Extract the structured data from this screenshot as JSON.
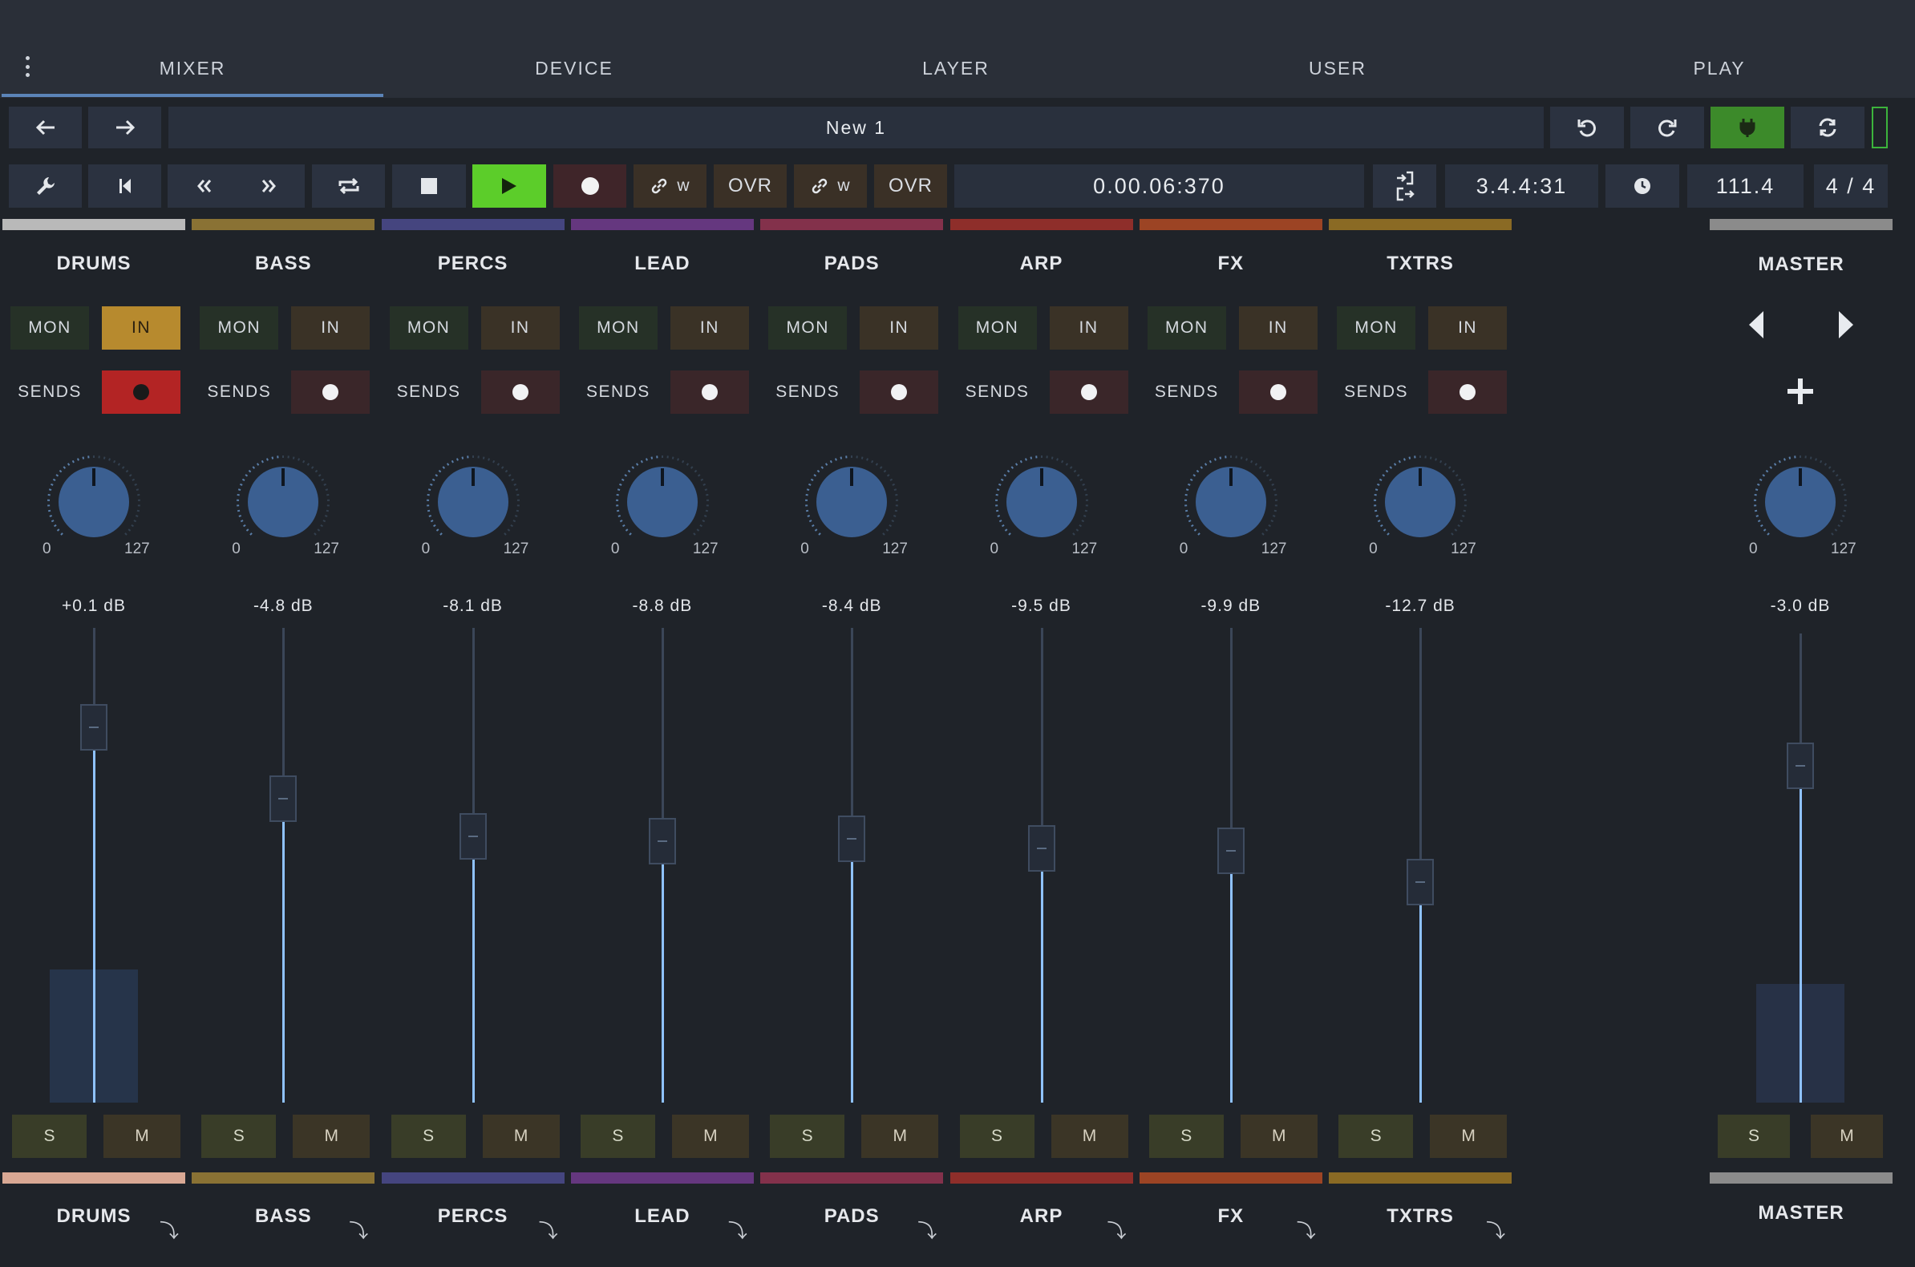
{
  "tabs": [
    {
      "label": "MIXER",
      "active": true
    },
    {
      "label": "DEVICE",
      "active": false
    },
    {
      "label": "LAYER",
      "active": false
    },
    {
      "label": "USER",
      "active": false
    },
    {
      "label": "PLAY",
      "active": false
    }
  ],
  "toolbar": {
    "project_name": "New 1",
    "time": "0.00.06:370",
    "position": "3.4.4:31",
    "tempo": "111.4",
    "time_signature": "4 / 4",
    "link1_label": "w",
    "overdub1_label": "OVR",
    "link2_label": "w",
    "overdub2_label": "OVR"
  },
  "tracks": [
    {
      "name": "DRUMS",
      "color": "#b9b9b9",
      "bottom_color": "#d9a894",
      "mon": "MON",
      "in": "IN",
      "in_active": true,
      "sends": "SENDS",
      "rec_active": true,
      "knob_min": "0",
      "knob_max": "127",
      "volume": "+0.1 dB",
      "fader_level": 0.79,
      "meter_level": 0.28,
      "solo": "S",
      "mute": "M",
      "routing": "⤵"
    },
    {
      "name": "BASS",
      "color": "#8a7234",
      "bottom_color": "#8a7234",
      "mon": "MON",
      "in": "IN",
      "in_active": false,
      "sends": "SENDS",
      "rec_active": false,
      "knob_min": "0",
      "knob_max": "127",
      "volume": "-4.8 dB",
      "fader_level": 0.64,
      "meter_level": 0,
      "solo": "S",
      "mute": "M",
      "routing": "⤵"
    },
    {
      "name": "PERCS",
      "color": "#45457f",
      "bottom_color": "#45457f",
      "mon": "MON",
      "in": "IN",
      "in_active": false,
      "sends": "SENDS",
      "rec_active": false,
      "knob_min": "0",
      "knob_max": "127",
      "volume": "-8.1 dB",
      "fader_level": 0.56,
      "meter_level": 0,
      "solo": "S",
      "mute": "M",
      "routing": "⤵"
    },
    {
      "name": "LEAD",
      "color": "#65377f",
      "bottom_color": "#65377f",
      "mon": "MON",
      "in": "IN",
      "in_active": false,
      "sends": "SENDS",
      "rec_active": false,
      "knob_min": "0",
      "knob_max": "127",
      "volume": "-8.8 dB",
      "fader_level": 0.55,
      "meter_level": 0,
      "solo": "S",
      "mute": "M",
      "routing": "⤵"
    },
    {
      "name": "PADS",
      "color": "#83314b",
      "bottom_color": "#83314b",
      "mon": "MON",
      "in": "IN",
      "in_active": false,
      "sends": "SENDS",
      "rec_active": false,
      "knob_min": "0",
      "knob_max": "127",
      "volume": "-8.4 dB",
      "fader_level": 0.555,
      "meter_level": 0,
      "solo": "S",
      "mute": "M",
      "routing": "⤵"
    },
    {
      "name": "ARP",
      "color": "#8e2e2a",
      "bottom_color": "#8e2e2a",
      "mon": "MON",
      "in": "IN",
      "in_active": false,
      "sends": "SENDS",
      "rec_active": false,
      "knob_min": "0",
      "knob_max": "127",
      "volume": "-9.5 dB",
      "fader_level": 0.535,
      "meter_level": 0,
      "solo": "S",
      "mute": "M",
      "routing": "⤵"
    },
    {
      "name": "FX",
      "color": "#9c4424",
      "bottom_color": "#9c4424",
      "mon": "MON",
      "in": "IN",
      "in_active": false,
      "sends": "SENDS",
      "rec_active": false,
      "knob_min": "0",
      "knob_max": "127",
      "volume": "-9.9 dB",
      "fader_level": 0.53,
      "meter_level": 0,
      "solo": "S",
      "mute": "M",
      "routing": "⤵"
    },
    {
      "name": "TXTRS",
      "color": "#8a6a24",
      "bottom_color": "#8a6a24",
      "mon": "MON",
      "in": "IN",
      "in_active": false,
      "sends": "SENDS",
      "rec_active": false,
      "knob_min": "0",
      "knob_max": "127",
      "volume": "-12.7 dB",
      "fader_level": 0.465,
      "meter_level": 0,
      "solo": "S",
      "mute": "M",
      "routing": "⤵"
    }
  ],
  "master": {
    "name": "MASTER",
    "color": "#8b8b8b",
    "knob_min": "0",
    "knob_max": "127",
    "volume": "-3.0 dB",
    "fader_level": 0.71,
    "meter_level": 0.25,
    "solo": "S",
    "mute": "M"
  }
}
